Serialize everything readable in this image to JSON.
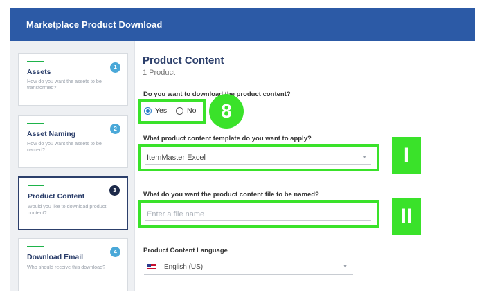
{
  "header": {
    "title": "Marketplace Product Download"
  },
  "steps": [
    {
      "num": "1",
      "title": "Assets",
      "desc": "How do you want the assets to be transformed?"
    },
    {
      "num": "2",
      "title": "Asset Naming",
      "desc": "How do you want the assets to be named?"
    },
    {
      "num": "3",
      "title": "Product Content",
      "desc": "Would you like to download product content?"
    },
    {
      "num": "4",
      "title": "Download Email",
      "desc": "Who should receive this download?"
    }
  ],
  "main": {
    "title": "Product Content",
    "subtitle": "1 Product",
    "q1": "Do you want to download the product content?",
    "yes_label": "Yes",
    "no_label": "No",
    "q2": "What product content template do you want to apply?",
    "template_value": "ItemMaster Excel",
    "q3": "What do you want the product content file to be named?",
    "filename_placeholder": "Enter a file name",
    "q4": "Product Content Language",
    "language_value": "English (US)"
  },
  "annotations": {
    "badge_radio": "8",
    "badge_template": "I",
    "badge_filename": "II"
  },
  "colors": {
    "header": "#2c5aa6",
    "highlight": "#3ae22a",
    "step_bar": "#1eb34a",
    "step_badge": "#4aa8d8",
    "active_badge": "#1d2a4a"
  }
}
